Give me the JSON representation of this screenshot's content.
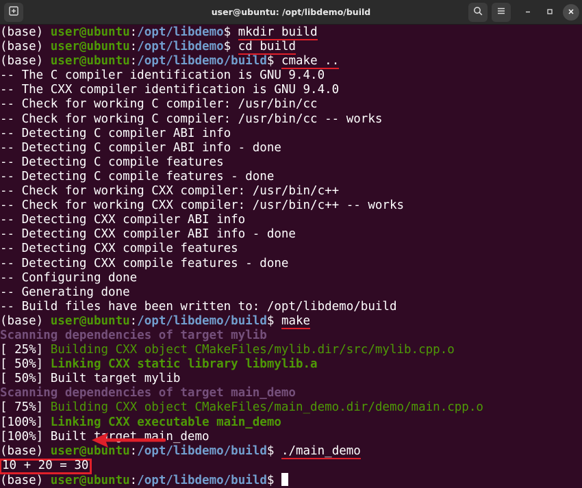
{
  "window": {
    "title": "user@ubuntu: /opt/libdemo/build",
    "new_tab_icon": "new-tab-icon",
    "search_icon": "search-icon",
    "menu_icon": "hamburger-menu-icon"
  },
  "prompt": {
    "env": "(base)",
    "user_host": "user@ubuntu",
    "colon": ":"
  },
  "lines": [
    {
      "type": "prompt",
      "path": "/opt/libdemo",
      "cmd": "mkdir build"
    },
    {
      "type": "prompt",
      "path": "/opt/libdemo",
      "cmd": "cd build"
    },
    {
      "type": "prompt",
      "path": "/opt/libdemo/build",
      "cmd": "cmake .."
    },
    {
      "type": "text",
      "text": "-- The C compiler identification is GNU 9.4.0"
    },
    {
      "type": "text",
      "text": "-- The CXX compiler identification is GNU 9.4.0"
    },
    {
      "type": "text",
      "text": "-- Check for working C compiler: /usr/bin/cc"
    },
    {
      "type": "text",
      "text": "-- Check for working C compiler: /usr/bin/cc -- works"
    },
    {
      "type": "text",
      "text": "-- Detecting C compiler ABI info"
    },
    {
      "type": "text",
      "text": "-- Detecting C compiler ABI info - done"
    },
    {
      "type": "text",
      "text": "-- Detecting C compile features"
    },
    {
      "type": "text",
      "text": "-- Detecting C compile features - done"
    },
    {
      "type": "text",
      "text": "-- Check for working CXX compiler: /usr/bin/c++"
    },
    {
      "type": "text",
      "text": "-- Check for working CXX compiler: /usr/bin/c++ -- works"
    },
    {
      "type": "text",
      "text": "-- Detecting CXX compiler ABI info"
    },
    {
      "type": "text",
      "text": "-- Detecting CXX compiler ABI info - done"
    },
    {
      "type": "text",
      "text": "-- Detecting CXX compile features"
    },
    {
      "type": "text",
      "text": "-- Detecting CXX compile features - done"
    },
    {
      "type": "text",
      "text": "-- Configuring done"
    },
    {
      "type": "text",
      "text": "-- Generating done"
    },
    {
      "type": "text",
      "text": "-- Build files have been written to: /opt/libdemo/build"
    },
    {
      "type": "prompt",
      "path": "/opt/libdemo/build",
      "cmd": "make"
    },
    {
      "type": "scan",
      "text": "Scanning dependencies of target mylib"
    },
    {
      "type": "build",
      "prefix": "[ 25%] ",
      "text": "Building CXX object CMakeFiles/mylib.dir/src/mylib.cpp.o",
      "style": "ogreen"
    },
    {
      "type": "build",
      "prefix": "[ 50%] ",
      "text": "Linking CXX static library libmylib.a",
      "style": "bgreen"
    },
    {
      "type": "text",
      "text": "[ 50%] Built target mylib"
    },
    {
      "type": "scan",
      "text": "Scanning dependencies of target main_demo"
    },
    {
      "type": "build",
      "prefix": "[ 75%] ",
      "text": "Building CXX object CMakeFiles/main_demo.dir/demo/main.cpp.o",
      "style": "ogreen"
    },
    {
      "type": "build",
      "prefix": "[100%] ",
      "text": "Linking CXX executable main_demo",
      "style": "bgreen"
    },
    {
      "type": "text",
      "text": "[100%] Built target main_demo"
    },
    {
      "type": "prompt",
      "path": "/opt/libdemo/build",
      "cmd": "./main_demo"
    },
    {
      "type": "result",
      "text": "10 + 20 = 30"
    },
    {
      "type": "prompt",
      "path": "/opt/libdemo/build",
      "cmd": "",
      "cursor": true
    }
  ],
  "colors": {
    "background": "#300a24",
    "prompt_green": "#4e9a06",
    "path_blue": "#729fcf",
    "scan_purple": "#75507b",
    "annotation_red": "#e0202a"
  }
}
